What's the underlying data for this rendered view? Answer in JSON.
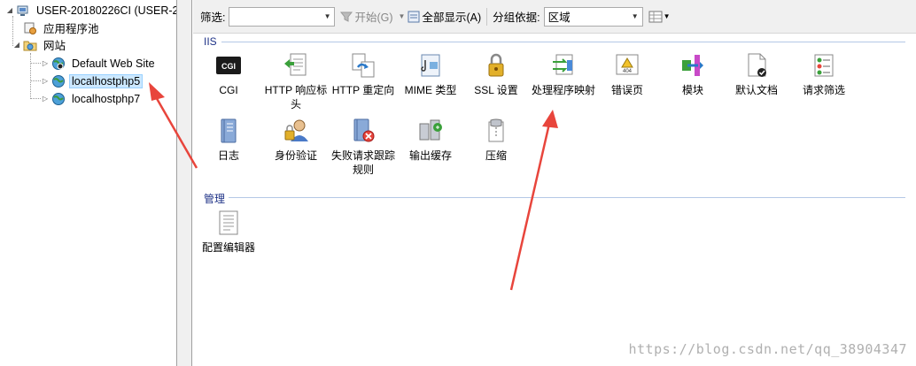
{
  "tree": {
    "root": "USER-20180226CI (USER-2",
    "app_pools": "应用程序池",
    "sites": "网站",
    "site_items": [
      "Default Web Site",
      "localhostphp5",
      "localhostphp7"
    ]
  },
  "toolbar": {
    "filter_label": "筛选:",
    "filter_value": "",
    "start_label": "开始(G)",
    "show_all_label": "全部显示(A)",
    "group_by_label": "分组依据:",
    "group_by_value": "区域"
  },
  "sections": {
    "iis": "IIS",
    "manage": "管理"
  },
  "iis_features": [
    "CGI",
    "HTTP 响应标头",
    "HTTP 重定向",
    "MIME 类型",
    "SSL 设置",
    "处理程序映射",
    "错误页",
    "模块",
    "默认文档",
    "请求筛选",
    "日志",
    "身份验证",
    "失败请求跟踪规则",
    "输出缓存",
    "压缩"
  ],
  "manage_features": [
    "配置编辑器"
  ],
  "watermark": "https://blog.csdn.net/qq_38904347",
  "colors": {
    "annotation": "#e8453c",
    "section_text": "#1e3287"
  }
}
